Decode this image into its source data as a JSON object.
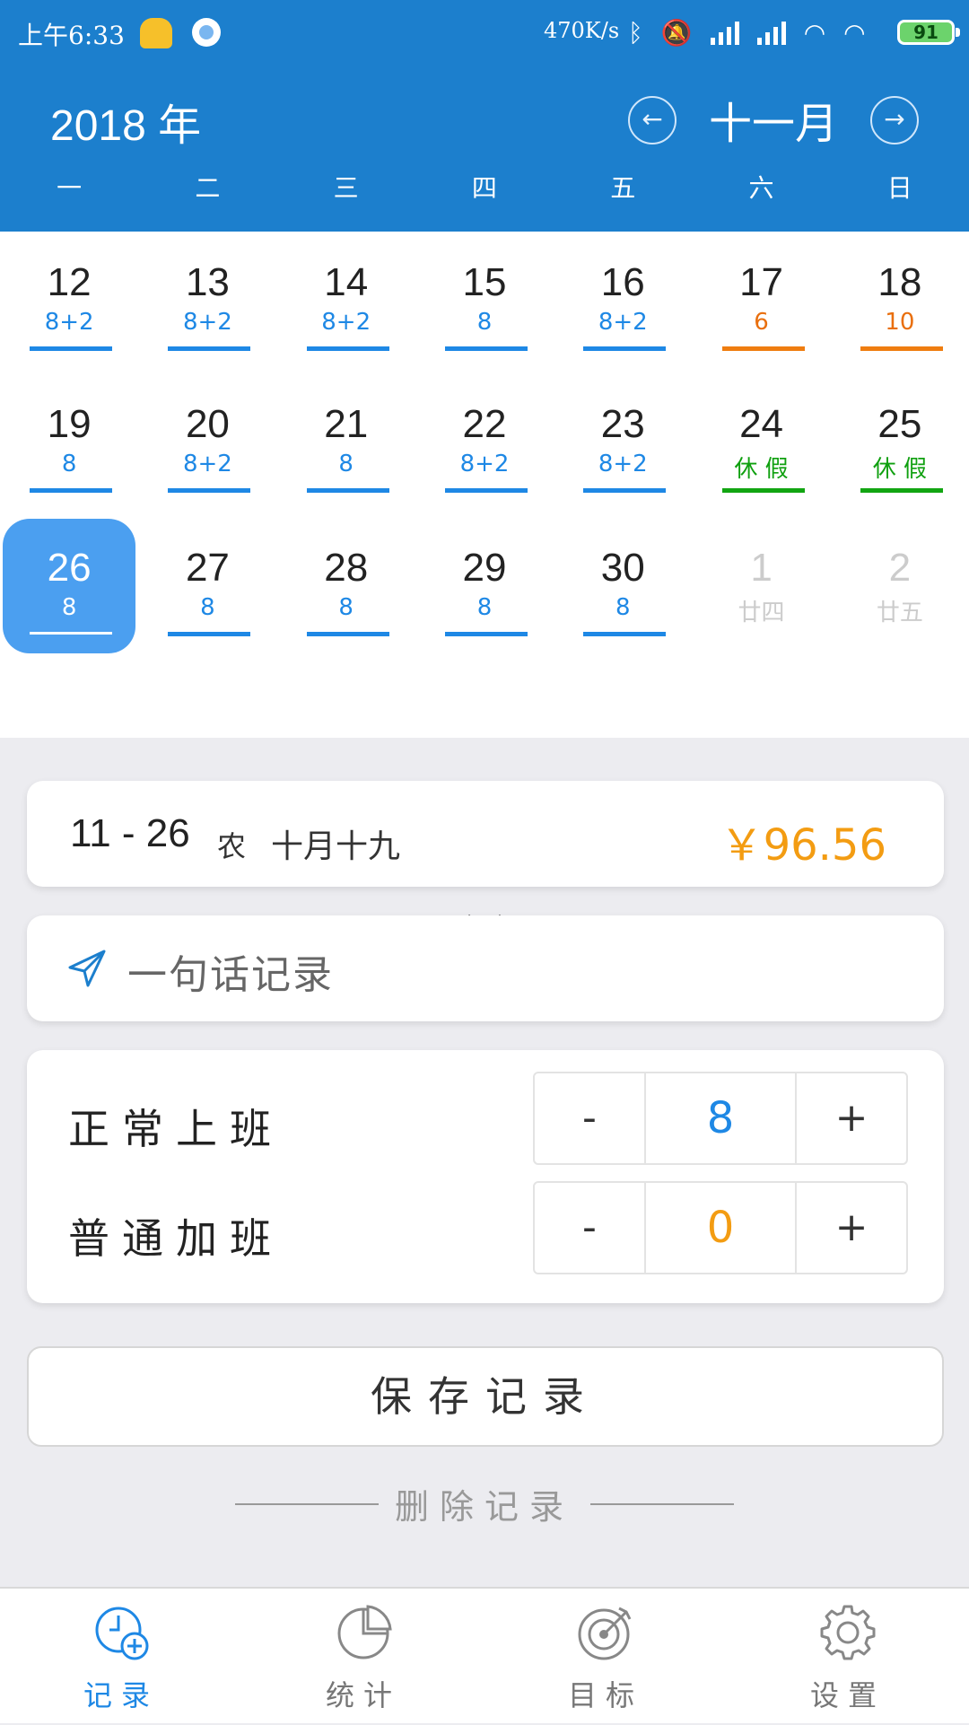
{
  "status_bar": {
    "time": "上午6:33",
    "network_speed": "470K/s",
    "battery": "91"
  },
  "header": {
    "year": "2018 年",
    "month": "十一月",
    "prev_icon": "←",
    "next_icon": "→",
    "weekdays": [
      "一",
      "二",
      "三",
      "四",
      "五",
      "六",
      "日"
    ]
  },
  "calendar": {
    "weeks": [
      [
        {
          "num": "12",
          "sub": "8+2",
          "style": "blue"
        },
        {
          "num": "13",
          "sub": "8+2",
          "style": "blue"
        },
        {
          "num": "14",
          "sub": "8+2",
          "style": "blue"
        },
        {
          "num": "15",
          "sub": "8",
          "style": "blue"
        },
        {
          "num": "16",
          "sub": "8+2",
          "style": "blue"
        },
        {
          "num": "17",
          "sub": "6",
          "style": "orange"
        },
        {
          "num": "18",
          "sub": "10",
          "style": "orange"
        }
      ],
      [
        {
          "num": "19",
          "sub": "8",
          "style": "blue"
        },
        {
          "num": "20",
          "sub": "8+2",
          "style": "blue"
        },
        {
          "num": "21",
          "sub": "8",
          "style": "blue"
        },
        {
          "num": "22",
          "sub": "8+2",
          "style": "blue"
        },
        {
          "num": "23",
          "sub": "8+2",
          "style": "blue"
        },
        {
          "num": "24",
          "sub": "休 假",
          "style": "green"
        },
        {
          "num": "25",
          "sub": "休 假",
          "style": "green"
        }
      ],
      [
        {
          "num": "26",
          "sub": "8",
          "style": "selected"
        },
        {
          "num": "27",
          "sub": "8",
          "style": "blue"
        },
        {
          "num": "28",
          "sub": "8",
          "style": "blue"
        },
        {
          "num": "29",
          "sub": "8",
          "style": "blue"
        },
        {
          "num": "30",
          "sub": "8",
          "style": "blue"
        },
        {
          "num": "1",
          "sub": "廿四",
          "style": "faded"
        },
        {
          "num": "2",
          "sub": "廿五",
          "style": "faded"
        }
      ]
    ]
  },
  "day_summary": {
    "date": "11 - 26",
    "lunar_label": "农",
    "lunar_date": "十月十九",
    "amount": "￥96.56"
  },
  "quick_record": {
    "placeholder": "一句话记录"
  },
  "hours": {
    "normal": {
      "label": "正常上班",
      "value": "8",
      "minus": "-",
      "plus": "+"
    },
    "overtime": {
      "label": "普通加班",
      "value": "0",
      "minus": "-",
      "plus": "+"
    }
  },
  "actions": {
    "save": "保存记录",
    "delete": "删除记录"
  },
  "bottom_nav": [
    {
      "label": "记录",
      "icon": "clock-add-icon",
      "active": true
    },
    {
      "label": "统计",
      "icon": "pie-chart-icon",
      "active": false
    },
    {
      "label": "目标",
      "icon": "target-icon",
      "active": false
    },
    {
      "label": "设置",
      "icon": "gear-icon",
      "active": false
    }
  ],
  "colors": {
    "header": "#1c7fcd",
    "accent": "#1e88e5",
    "orange": "#f39c12",
    "green": "#12a512",
    "selected": "#4b9ff0"
  }
}
